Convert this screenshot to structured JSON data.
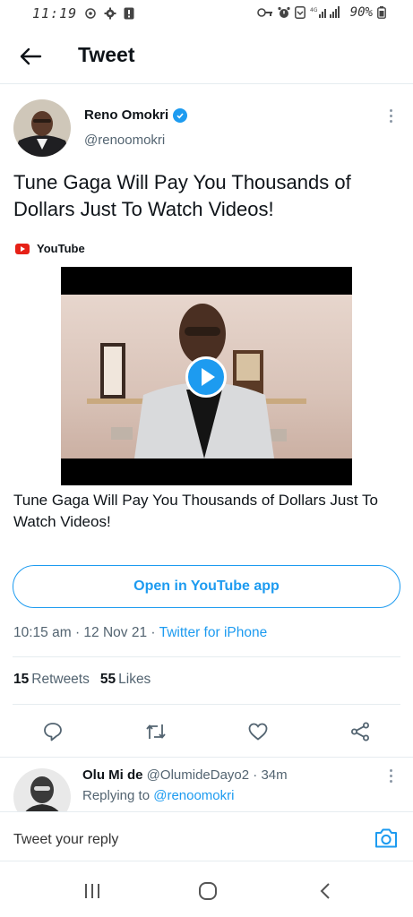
{
  "status_bar": {
    "time": "11:19",
    "battery": "90%",
    "left_icons": [
      "cloud-settings-icon",
      "gear-icon",
      "alert-icon"
    ],
    "right_icons": [
      "key-icon",
      "alarm-icon",
      "download-icon",
      "signal-icon",
      "battery-icon"
    ]
  },
  "header": {
    "title": "Tweet"
  },
  "tweet": {
    "author_name": "Reno Omokri",
    "author_handle": "@renoomokri",
    "text": "Tune Gaga Will Pay You Thousands of Dollars Just To Watch Videos!",
    "card": {
      "source": "YouTube",
      "title": "Tune Gaga Will Pay You Thousands of Dollars Just To Watch Videos!",
      "open_button": "Open in YouTube app"
    },
    "time": "10:15 am",
    "date": "12 Nov 21",
    "client": "Twitter for iPhone",
    "retweets": "15",
    "retweets_label": "Retweets",
    "likes": "55",
    "likes_label": "Likes"
  },
  "reply": {
    "name": "Olu Mi de",
    "handle": "@OlumideDayo2",
    "age": "34m",
    "replying_prefix": "Replying to",
    "replying_to": "@renoomokri"
  },
  "composer": {
    "placeholder": "Tweet your reply"
  },
  "colors": {
    "accent": "#1d9bf0",
    "text": "#0f1419",
    "secondary": "#536471",
    "youtube": "#e62117"
  }
}
